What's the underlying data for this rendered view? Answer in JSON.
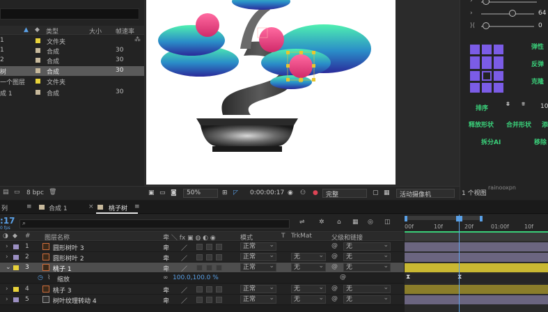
{
  "project": {
    "columns": {
      "type": "类型",
      "size": "大小",
      "rate": "帧速率"
    },
    "items": [
      {
        "name": "1",
        "color": "#e8d23a",
        "type": "文件夹",
        "size": ""
      },
      {
        "name": "1",
        "color": "#c7b99c",
        "type": "合成",
        "size": "30"
      },
      {
        "name": "2",
        "color": "#c7b99c",
        "type": "合成",
        "size": "30"
      },
      {
        "name": "树",
        "color": "#c7b99c",
        "type": "合成",
        "size": "30",
        "selected": true
      },
      {
        "name": "一个图层",
        "color": "#e8d23a",
        "type": "文件夹",
        "size": ""
      },
      {
        "name": "成 1",
        "color": "#c7b99c",
        "type": "合成",
        "size": "30"
      }
    ],
    "bpc": "8 bpc"
  },
  "viewer": {
    "zoom": "50%",
    "timecode": "0:00:00:17",
    "quality": "完整",
    "camera": "活动摄像机",
    "views": "1 个视图",
    "watermark": "rainooxpn"
  },
  "plugin": {
    "value_1": "64",
    "value_2": "0",
    "value_3": "10",
    "buttons": {
      "elastic": "弹性",
      "bounce": "反弹",
      "clone": "克隆",
      "sort": "排序",
      "release_shapes": "释放形状",
      "merge_shapes": "合并形状",
      "add": "添",
      "split_ai": "拆分AI",
      "remove": "移除"
    }
  },
  "timeline": {
    "tabs": {
      "tab_1": "列",
      "tab_2": "合成 1",
      "tab_3": "桃子树"
    },
    "current_time": ":17",
    "current_time_sub": "0 fps",
    "search_placeholder": "",
    "columns": {
      "name": "图层名称",
      "mode": "模式",
      "t": "T",
      "trkmat": "TrkMat",
      "parent": "父级和链接"
    },
    "ruler": [
      "00f",
      "10f",
      "20f",
      "01:00f",
      "10f"
    ],
    "layers": [
      {
        "num": "1",
        "name": "圆形树叶 3",
        "color": "#9b8fc2",
        "mode": "正常",
        "trkmat": "",
        "parent": "无",
        "bar_color": "#6b6580"
      },
      {
        "num": "2",
        "name": "圆形树叶 2",
        "color": "#9b8fc2",
        "mode": "正常",
        "trkmat": "无",
        "parent": "无",
        "bar_color": "#6b6580"
      },
      {
        "num": "3",
        "name": "桃子 1",
        "color": "#e8d23a",
        "mode": "正常",
        "trkmat": "无",
        "parent": "无",
        "bar_color": "#c9b832",
        "selected": true
      },
      {
        "num": "",
        "name": "缩放",
        "color": "",
        "mode": "",
        "trkmat": "",
        "parent": "",
        "value": "100.0,100.0 %",
        "is_prop": true
      },
      {
        "num": "4",
        "name": "桃子 3",
        "color": "#e8d23a",
        "mode": "正常",
        "trkmat": "无",
        "parent": "无",
        "bar_color": "#8a7d2a"
      },
      {
        "num": "5",
        "name": "树叶纹理转动 4",
        "color": "#9b8fc2",
        "mode": "正常",
        "trkmat": "无",
        "parent": "无",
        "bar_color": "#6b6580"
      }
    ]
  }
}
